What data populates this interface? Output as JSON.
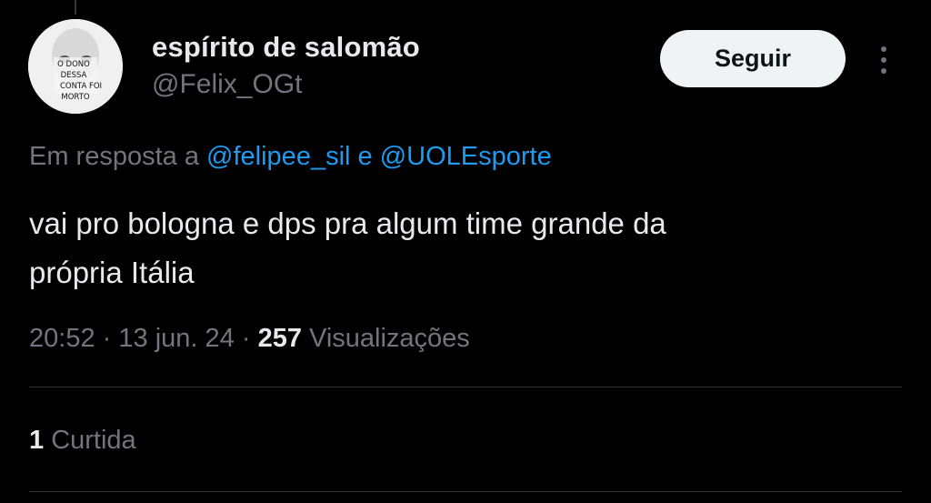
{
  "author": {
    "display_name": "espírito de salomão",
    "handle": "@Felix_OGt",
    "avatar_caption": [
      "O DONO",
      "DESSA",
      "CONTA FOI",
      "MORTO"
    ]
  },
  "actions": {
    "follow_label": "Seguir",
    "more_icon": "more-vertical-icon"
  },
  "reply_context": {
    "prefix": "Em resposta a",
    "mentions": [
      "@felipee_sil",
      "@UOLEsporte"
    ],
    "connector": "e"
  },
  "tweet": {
    "text_line_1": "vai pro bologna e dps pra algum time grande da",
    "text_line_2": "própria Itália"
  },
  "meta": {
    "time": "20:52",
    "separator": "·",
    "date": "13 jun. 24",
    "views_count": "257",
    "views_label": "Visualizações"
  },
  "engagement": {
    "likes_count": "1",
    "likes_label": "Curtida"
  },
  "colors": {
    "background": "#000000",
    "text_primary": "#e7e9ea",
    "text_secondary": "#71767b",
    "link": "#1d9bf0",
    "button_bg": "#eff3f4",
    "divider": "#2f3336"
  }
}
